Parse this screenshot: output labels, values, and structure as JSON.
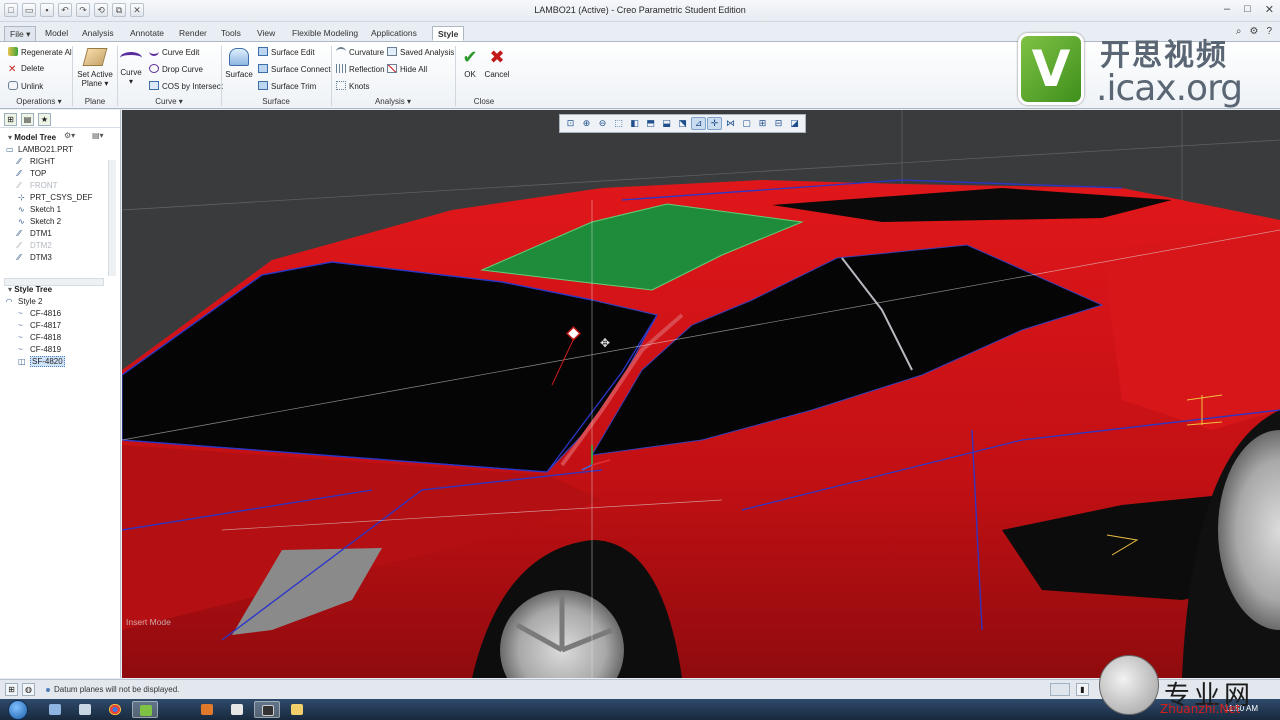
{
  "window": {
    "title": "LAMBO21 (Active) - Creo Parametric Student Edition"
  },
  "quick_access": [
    "new-icon",
    "open-icon",
    "save-icon",
    "undo-icon",
    "redo-icon",
    "regenerate-icon",
    "windows-icon",
    "close-icon"
  ],
  "tabs": [
    {
      "label": "File"
    },
    {
      "label": "Model"
    },
    {
      "label": "Analysis"
    },
    {
      "label": "Annotate"
    },
    {
      "label": "Render"
    },
    {
      "label": "Tools"
    },
    {
      "label": "View"
    },
    {
      "label": "Flexible Modeling"
    },
    {
      "label": "Applications"
    },
    {
      "label": "Style"
    }
  ],
  "ribbon": {
    "operations": {
      "regenerate_all": "Regenerate All",
      "delete": "Delete",
      "unlink": "Unlink",
      "group": "Operations"
    },
    "plane": {
      "set_active_plane": "Set Active",
      "set_active_plane_2": "Plane",
      "group": "Plane"
    },
    "curve": {
      "curve": "Curve",
      "curve_edit": "Curve Edit",
      "drop_curve": "Drop Curve",
      "cos_by_intersect": "COS by Intersect",
      "group": "Curve"
    },
    "surface": {
      "surface": "Surface",
      "surface_edit": "Surface Edit",
      "surface_connect": "Surface Connect",
      "surface_trim": "Surface Trim",
      "group": "Surface"
    },
    "analysis": {
      "curvature": "Curvature",
      "reflection": "Reflection",
      "knots": "Knots",
      "saved_analysis": "Saved Analysis",
      "hide_all": "Hide All",
      "group": "Analysis"
    },
    "close": {
      "ok": "OK",
      "cancel": "Cancel",
      "group": "Close"
    }
  },
  "model_tree": {
    "header": "Model Tree",
    "items": [
      {
        "label": "LAMBO21.PRT",
        "icon": "part-icon",
        "dim": false
      },
      {
        "label": "RIGHT",
        "icon": "datum-plane-icon",
        "dim": false
      },
      {
        "label": "TOP",
        "icon": "datum-plane-icon",
        "dim": false
      },
      {
        "label": "FRONT",
        "icon": "datum-plane-icon",
        "dim": true
      },
      {
        "label": "PRT_CSYS_DEF",
        "icon": "csys-icon",
        "dim": false
      },
      {
        "label": "Sketch 1",
        "icon": "sketch-icon",
        "dim": false
      },
      {
        "label": "Sketch 2",
        "icon": "sketch-icon",
        "dim": false
      },
      {
        "label": "DTM1",
        "icon": "datum-plane-icon",
        "dim": false
      },
      {
        "label": "DTM2",
        "icon": "datum-plane-icon",
        "dim": true
      },
      {
        "label": "DTM3",
        "icon": "datum-plane-icon",
        "dim": false
      }
    ]
  },
  "style_tree": {
    "header": "Style Tree",
    "items": [
      {
        "label": "Style 2",
        "icon": "style-icon",
        "selected": false
      },
      {
        "label": "CF-4816",
        "icon": "curve-icon",
        "selected": false
      },
      {
        "label": "CF-4817",
        "icon": "curve-icon",
        "selected": false
      },
      {
        "label": "CF-4818",
        "icon": "curve-icon",
        "selected": false
      },
      {
        "label": "CF-4819",
        "icon": "curve-icon",
        "selected": false
      },
      {
        "label": "SF-4820",
        "icon": "surface-icon",
        "selected": true
      }
    ]
  },
  "viewport": {
    "mode_label": "Insert Mode",
    "toolbar": [
      "refit-icon",
      "zoom-in-icon",
      "zoom-out-icon",
      "repaint-icon",
      "display-style-icon",
      "saved-orientations-icon",
      "view-manager-icon",
      "perspective-icon",
      "datum-display-icon",
      "spin-center-icon",
      "annotation-display-icon",
      "point-display-icon",
      "csys-display-icon",
      "filter-icon"
    ],
    "colors": {
      "body": "#c81316",
      "glass": "#050505",
      "selected_surface": "#1e8c3a",
      "background": "#3a3b3d"
    }
  },
  "status": {
    "message": "Datum planes will not be displayed."
  },
  "watermark": {
    "logo_letter": "V",
    "cn_title": "开思视频",
    "url": ".icax.org",
    "zh_site": "专业网",
    "zh_site_latin": "Zhuanzhi.Net"
  },
  "taskbar": {
    "clock": "11:50 AM"
  }
}
